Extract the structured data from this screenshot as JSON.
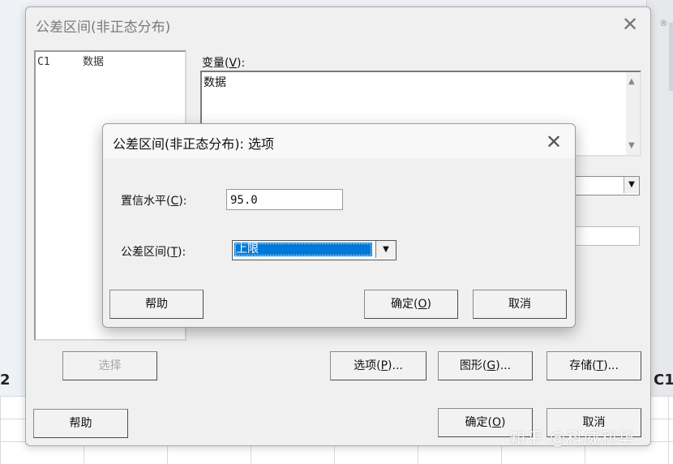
{
  "background": {
    "left_edge_label": "2",
    "right_edge_label": "C1",
    "reg_mark": "®"
  },
  "main_dialog": {
    "title": "公差区间(非正态分布)",
    "close_glyph": "✕",
    "variables_list": [
      {
        "col": "C1",
        "name": "数据"
      }
    ],
    "variable_label": "变量",
    "variable_hotkey": "V",
    "variable_value": "数据",
    "buttons": {
      "select": "选择",
      "options": "选项",
      "options_hotkey": "P",
      "graphs": "图形",
      "graphs_hotkey": "G",
      "storage": "存储",
      "storage_hotkey": "T",
      "help": "帮助",
      "ok": "确定",
      "ok_hotkey": "O",
      "cancel": "取消"
    }
  },
  "options_dialog": {
    "title": "公差区间(非正态分布): 选项",
    "close_glyph": "✕",
    "confidence_label": "置信水平",
    "confidence_hotkey": "C",
    "confidence_value": "95.0",
    "interval_label": "公差区间",
    "interval_hotkey": "T",
    "interval_selected": "上限",
    "buttons": {
      "help": "帮助",
      "ok": "确定",
      "ok_hotkey": "O",
      "cancel": "取消"
    }
  },
  "watermark": "知乎 @科威利华"
}
